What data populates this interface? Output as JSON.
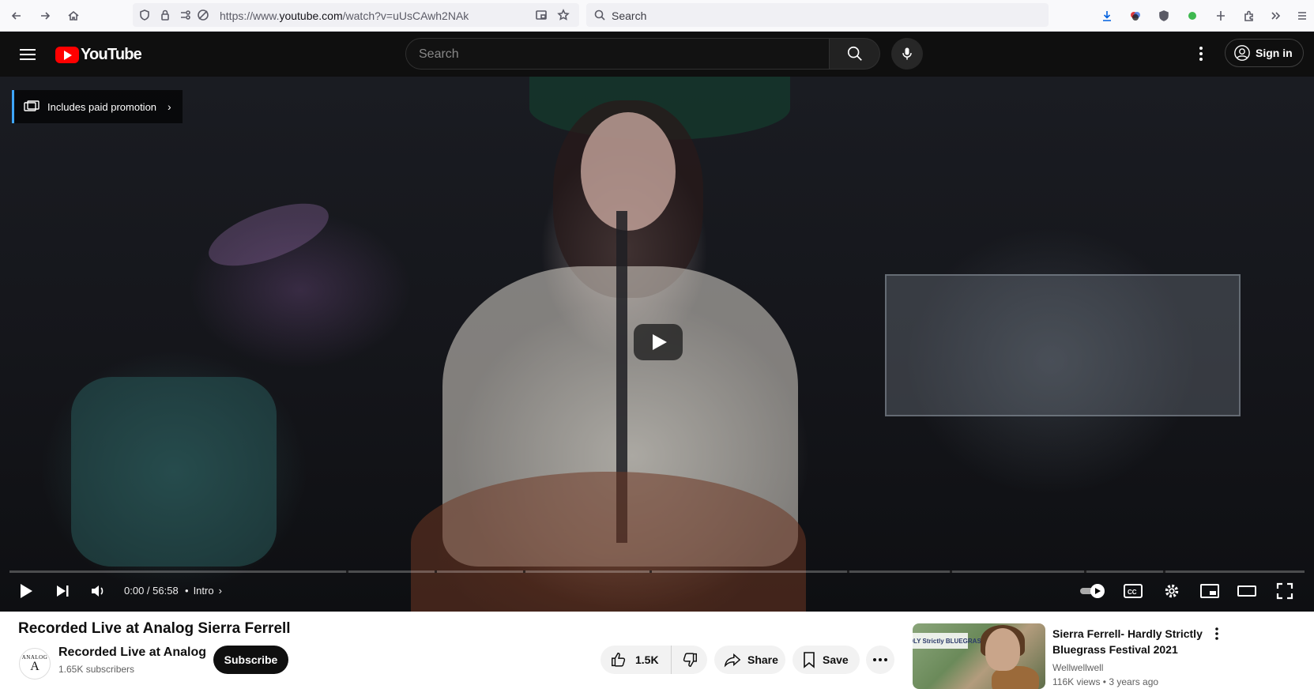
{
  "browser": {
    "url_prefix": "https://www.",
    "url_domain": "youtube.com",
    "url_path": "/watch?v=uUsCAwh2NAk",
    "search_placeholder": "Search"
  },
  "masthead": {
    "logo_text": "YouTube",
    "search_placeholder": "Search",
    "signin_label": "Sign in"
  },
  "player": {
    "promo_label": "Includes paid promotion",
    "time": "0:00 / 56:58",
    "chapter": "Intro",
    "progress_fraction": 0
  },
  "video": {
    "title": "Recorded Live at Analog Sierra Ferrell",
    "channel_name": "Recorded Live at Analog",
    "subscribers": "1.65K subscribers",
    "avatar_top": "ANALOG",
    "avatar_letter": "A",
    "subscribe_label": "Subscribe",
    "likes": "1.5K",
    "share_label": "Share",
    "save_label": "Save"
  },
  "recommended": [
    {
      "thumb_text": "HARDLY Strictly BLUEGRASS",
      "title": "Sierra Ferrell- Hardly Strictly Bluegrass Festival 2021",
      "channel": "Wellwellwell",
      "meta": "116K views • 3 years ago"
    }
  ],
  "colors": {
    "accent_red": "#ff0000",
    "promo_accent": "#3ea6ff",
    "dark_bg": "#0f0f0f"
  }
}
